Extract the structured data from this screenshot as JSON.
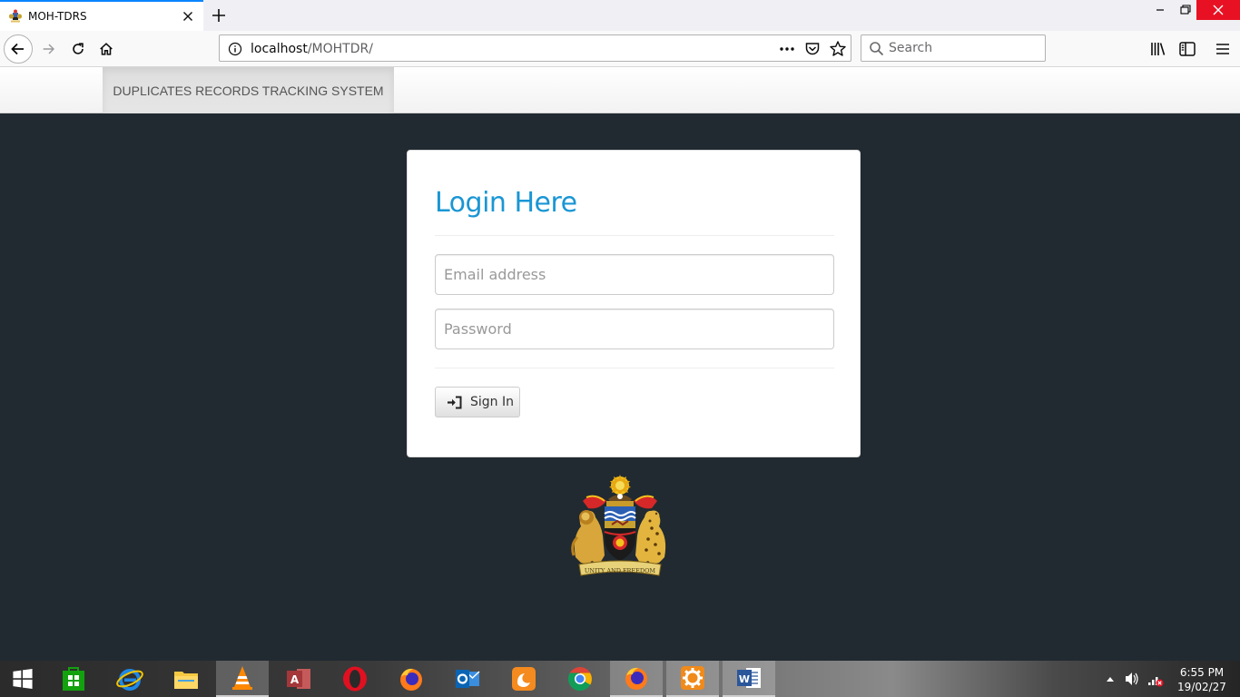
{
  "browser": {
    "tab_title": "MOH-TDRS",
    "url_host": "localhost",
    "url_path": "/MOHTDR/",
    "search_placeholder": "Search"
  },
  "site": {
    "brand": "DUPLICATES RECORDS TRACKING SYSTEM"
  },
  "login": {
    "title": "Login Here",
    "email_placeholder": "Email address",
    "password_placeholder": "Password",
    "signin_label": "Sign In"
  },
  "emblem": {
    "motto": "UNITY AND FREEDOM"
  },
  "taskbar": {
    "apps": [
      "windows-start",
      "store",
      "internet-explorer",
      "file-explorer",
      "vlc",
      "access",
      "opera",
      "firefox",
      "outlook",
      "uc-browser",
      "chrome",
      "firefox",
      "settings",
      "word"
    ],
    "time": "6:55 PM",
    "date": "19/02/27"
  },
  "colors": {
    "accent": "#1a96d4",
    "page_bg": "#212a31",
    "tab_accent": "#0a84ff"
  }
}
